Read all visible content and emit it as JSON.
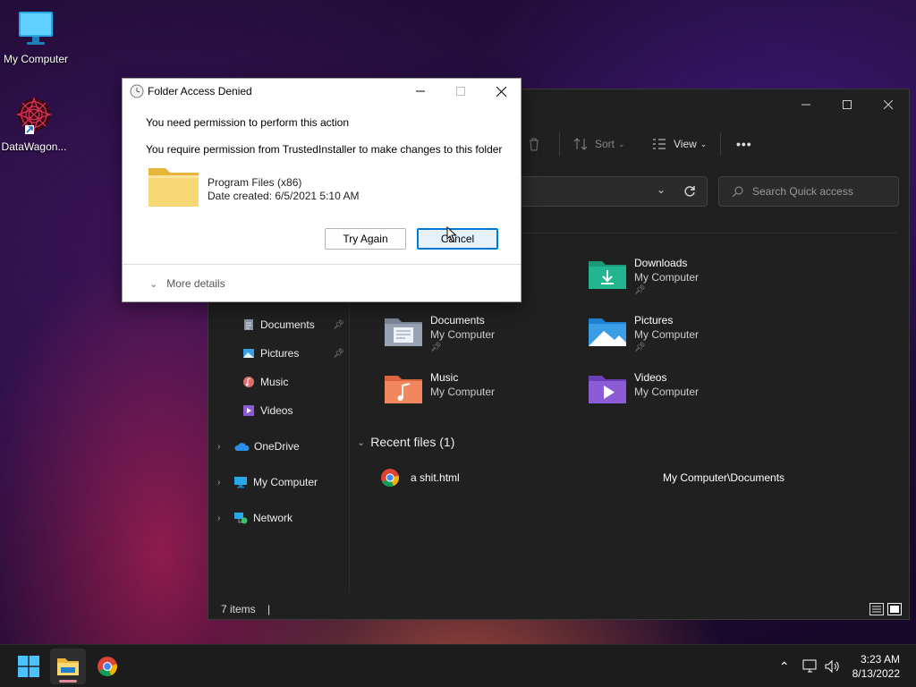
{
  "desktop": {
    "icons": [
      {
        "label": "My Computer",
        "icon": "monitor-icon"
      },
      {
        "label": "DataWagon...",
        "icon": "shortcut-icon"
      }
    ]
  },
  "explorer": {
    "toolbar": {
      "sort_label": "Sort",
      "view_label": "View",
      "more_label": "•••"
    },
    "search": {
      "placeholder": "Search Quick access"
    },
    "nav": [
      {
        "label": "Documents",
        "icon": "documents-icon",
        "pinned": true
      },
      {
        "label": "Pictures",
        "icon": "pictures-icon",
        "pinned": true
      },
      {
        "label": "Music",
        "icon": "music-icon",
        "pinned": false
      },
      {
        "label": "Videos",
        "icon": "videos-icon",
        "pinned": false
      },
      {
        "label": "OneDrive",
        "icon": "cloud-icon",
        "expandable": true
      },
      {
        "label": "My Computer",
        "icon": "monitor-icon",
        "expandable": true
      },
      {
        "label": "Network",
        "icon": "network-icon",
        "expandable": true
      }
    ],
    "quick_access": [
      {
        "name": "Downloads",
        "location": "My Computer",
        "pinned": true,
        "icon": "downloads-folder-icon"
      },
      {
        "name": "Documents",
        "location": "My Computer",
        "pinned": true,
        "icon": "documents-folder-icon"
      },
      {
        "name": "Pictures",
        "location": "My Computer",
        "pinned": true,
        "icon": "pictures-folder-icon"
      },
      {
        "name": "Music",
        "location": "My Computer",
        "pinned": false,
        "icon": "music-folder-icon"
      },
      {
        "name": "Videos",
        "location": "My Computer",
        "pinned": false,
        "icon": "videos-folder-icon"
      }
    ],
    "recent_header": "Recent files (1)",
    "recent_files": [
      {
        "name": "a shit.html",
        "path": "My Computer\\Documents",
        "icon": "chrome-icon"
      }
    ],
    "status": "7 items"
  },
  "dialog": {
    "title": "Folder Access Denied",
    "line1": "You need permission to perform this action",
    "line2": "You require permission from TrustedInstaller to make changes to this folder",
    "item_name": "Program Files (x86)",
    "item_date": "Date created: 6/5/2021 5:10 AM",
    "try_again": "Try Again",
    "cancel": "Cancel",
    "more_details": "More details"
  },
  "taskbar": {
    "time": "3:23 AM",
    "date": "8/13/2022"
  },
  "colors": {
    "accent": "#0078d4",
    "explorer_bg": "#202020",
    "folder_yellow": "#f5c84c"
  }
}
